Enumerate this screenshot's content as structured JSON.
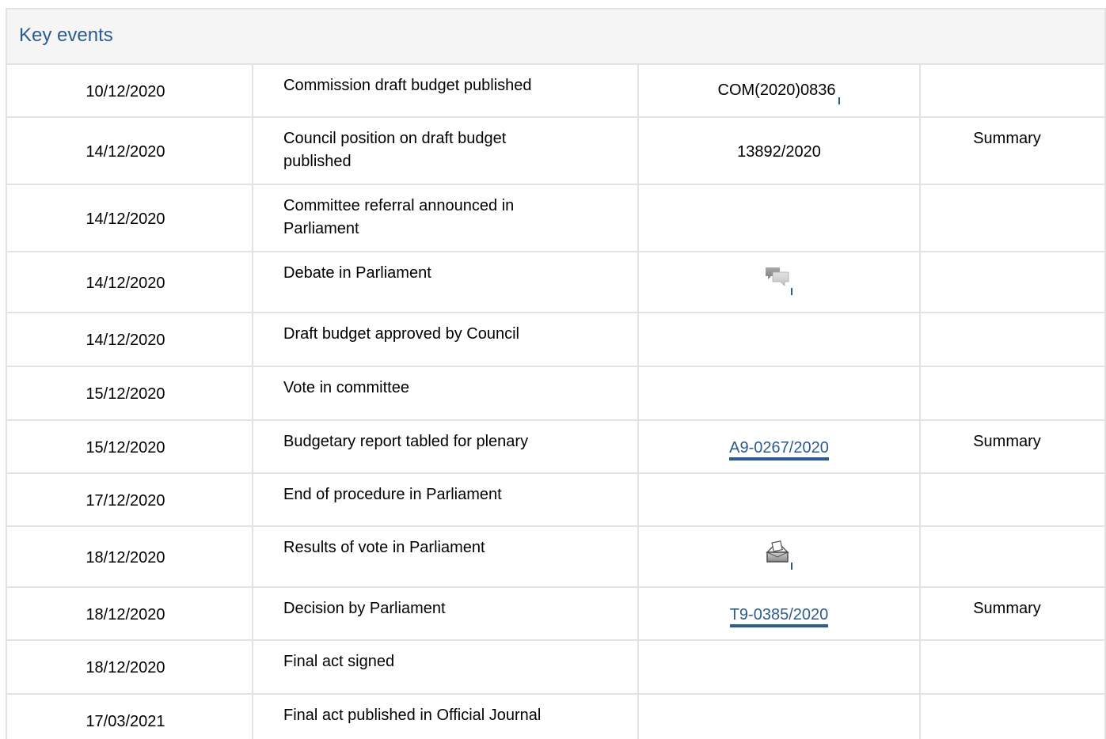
{
  "panel": {
    "title": "Key events"
  },
  "rows": [
    {
      "date": "10/12/2020",
      "event": "Commission draft budget published",
      "doc": "COM(2020)0836",
      "summary": ""
    },
    {
      "date": "14/12/2020",
      "event": "Council position on draft budget published",
      "doc": "13892/2020",
      "summary": "Summary"
    },
    {
      "date": "14/12/2020",
      "event": "Committee referral announced in Parliament",
      "doc": "",
      "summary": ""
    },
    {
      "date": "14/12/2020",
      "event": "Debate in Parliament",
      "doc_icon": "debate-icon",
      "summary": ""
    },
    {
      "date": "14/12/2020",
      "event": "Draft budget approved by Council",
      "doc": "",
      "summary": ""
    },
    {
      "date": "15/12/2020",
      "event": "Vote in committee",
      "doc": "",
      "summary": ""
    },
    {
      "date": "15/12/2020",
      "event": "Budgetary report tabled for plenary",
      "doc": "A9-0267/2020",
      "summary": "Summary"
    },
    {
      "date": "17/12/2020",
      "event": "End of procedure in Parliament",
      "doc": "",
      "summary": ""
    },
    {
      "date": "18/12/2020",
      "event": "Results of vote in Parliament",
      "doc_icon": "vote-results-icon",
      "summary": ""
    },
    {
      "date": "18/12/2020",
      "event": "Decision by Parliament",
      "doc": "T9-0385/2020",
      "summary": "Summary"
    },
    {
      "date": "18/12/2020",
      "event": "Final act signed",
      "doc": "",
      "summary": ""
    },
    {
      "date": "17/03/2021",
      "event": "Final act published in Official Journal",
      "doc": "",
      "summary": ""
    }
  ],
  "colors": {
    "link": "#2b5b8f",
    "border": "#e3e3e3",
    "header_bg": "#f5f5f5"
  }
}
